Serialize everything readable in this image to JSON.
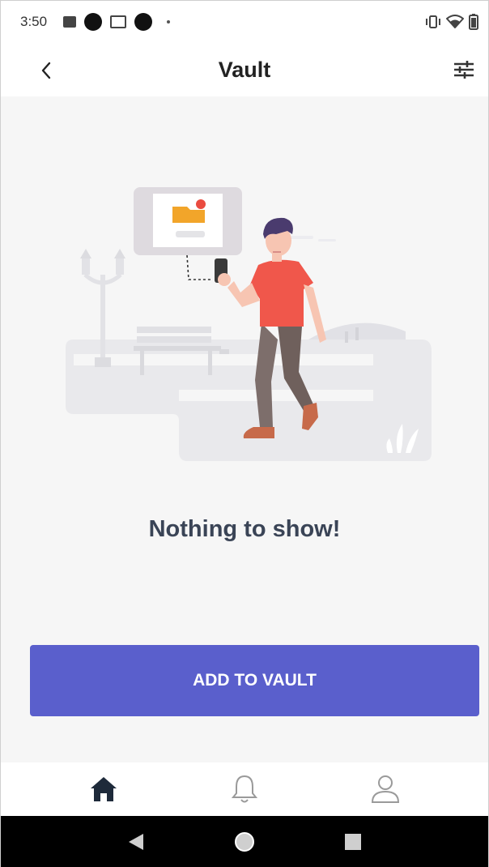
{
  "status_bar": {
    "time": "3:50",
    "icons": [
      "image-icon",
      "dot-icon",
      "mail-icon",
      "dot-icon",
      "small-dot-icon",
      "vibrate-icon",
      "wifi-icon",
      "battery-icon"
    ]
  },
  "app_bar": {
    "title": "Vault",
    "back_icon": "chevron-left-icon",
    "filter_icon": "tune-icon"
  },
  "empty_state": {
    "illustration": "person-walking-park-illustration",
    "message": "Nothing to show!"
  },
  "primary_action": {
    "label": "ADD TO VAULT",
    "color": "#5a5fcc"
  },
  "bottom_nav": {
    "items": [
      {
        "name": "home",
        "icon": "home-icon",
        "active": true
      },
      {
        "name": "notifications",
        "icon": "bell-icon",
        "active": false
      },
      {
        "name": "profile",
        "icon": "person-icon",
        "active": false
      }
    ]
  },
  "system_nav": {
    "items": [
      "back-triangle-icon",
      "home-circle-icon",
      "recents-square-icon"
    ]
  },
  "colors": {
    "accent": "#5a5fcc",
    "text_dark": "#3a4456",
    "background": "#f6f6f6",
    "shirt": "#f0574b"
  }
}
